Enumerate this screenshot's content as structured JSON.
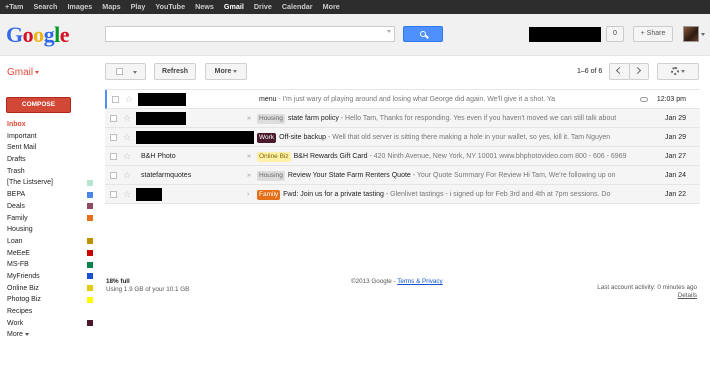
{
  "topbar": {
    "items": [
      "+Tam",
      "Search",
      "Images",
      "Maps",
      "Play",
      "YouTube",
      "News",
      "Gmail",
      "Drive",
      "Calendar",
      "More"
    ],
    "active": "Gmail"
  },
  "header": {
    "logo": {
      "l1": "G",
      "l2": "o",
      "l3": "o",
      "l4": "g",
      "l5": "l",
      "l6": "e"
    },
    "search_value": "",
    "notification_count": "0",
    "share_label": "+ Share"
  },
  "app_label": "Gmail",
  "toolbar": {
    "refresh": "Refresh",
    "more": "More",
    "pager": "1–6 of 6"
  },
  "sidebar": {
    "compose": "COMPOSE",
    "items": [
      {
        "label": "Inbox",
        "active": true,
        "color": ""
      },
      {
        "label": "Important",
        "color": ""
      },
      {
        "label": "Sent Mail",
        "color": ""
      },
      {
        "label": "Drafts",
        "color": ""
      },
      {
        "label": "Trash",
        "color": ""
      },
      {
        "label": "[The Listserve]",
        "color": "#b9e4d0"
      },
      {
        "label": "BEPA",
        "color": "#4a86e8"
      },
      {
        "label": "Deals",
        "color": "#8e4c5e"
      },
      {
        "label": "Family",
        "color": "#e66f1a"
      },
      {
        "label": "Housing",
        "color": ""
      },
      {
        "label": "Loan",
        "color": "#bf9000"
      },
      {
        "label": "MeEeE",
        "color": "#cc0000"
      },
      {
        "label": "MS-FB",
        "color": "#0b804b"
      },
      {
        "label": "MyFriends",
        "color": "#1c4fd1"
      },
      {
        "label": "Online Biz",
        "color": "#e6c911"
      },
      {
        "label": "Photog Biz",
        "color": "#ffff00"
      },
      {
        "label": "Recipes",
        "color": ""
      },
      {
        "label": "Work",
        "color": "#4a1a2c"
      },
      {
        "label": "More",
        "color": ""
      }
    ]
  },
  "messages": [
    {
      "sender": "",
      "redacted": true,
      "redact_w": 48,
      "important": "",
      "label": "",
      "subject": "menu",
      "snippet": " - I'm just wary of playing around and losing what George did again. We'll give it a shot. Ya",
      "attachment": true,
      "date": "12:03 pm"
    },
    {
      "sender": "",
      "redacted": true,
      "redact_w": 50,
      "important": "»",
      "label": "Housing",
      "label_bg": "#dddddd",
      "label_fg": "#666666",
      "subject": "state farm policy",
      "snippet": " - Hello Tam, Thanks for responding. Yes even if you haven't moved we can still talk about",
      "attachment": false,
      "date": "Jan 29"
    },
    {
      "sender": "",
      "redacted": true,
      "redact_w": 118,
      "important": "",
      "label": "Work",
      "label_bg": "#4a1a2c",
      "label_fg": "#ffffff",
      "subject": "Off-site backup",
      "snippet": " - Well that old server is sitting there making a hole in your wallet, so yes, kill it. Tam Nguyen",
      "attachment": false,
      "date": "Jan 29"
    },
    {
      "sender": "B&H Photo",
      "redacted": false,
      "important": "»",
      "label": "Online Biz",
      "label_bg": "#fff2a8",
      "label_fg": "#7a6200",
      "subject": "B&H Rewards Gift Card",
      "snippet": " - 420 Ninth Avenue, New York, NY 10001 www.bhphotovideo.com 800 - 606 - 6969",
      "attachment": false,
      "date": "Jan 27"
    },
    {
      "sender": "statefarmquotes",
      "redacted": false,
      "important": "»",
      "label": "Housing",
      "label_bg": "#dddddd",
      "label_fg": "#666666",
      "subject": "Review Your State Farm Renters Quote",
      "snippet": " - Your Quote Summary For Review Hi Tam, We're following up on",
      "attachment": false,
      "date": "Jan 24"
    },
    {
      "sender": "",
      "redacted": true,
      "redact_w": 26,
      "important": "›",
      "label": "Family",
      "label_bg": "#e66f1a",
      "label_fg": "#ffffff",
      "subject": "Fwd: Join us for a private tasting",
      "snippet": " - Glenlivet tastings - i signed up for Feb 3rd and 4th at 7pm sessions. Do",
      "attachment": false,
      "date": "Jan 22"
    }
  ],
  "footer": {
    "usage_percent": "18% full",
    "usage_detail": "Using 1.9 GB of your 10.1 GB",
    "copyright": "©2013 Google - ",
    "terms": "Terms & Privacy",
    "activity": "Last account activity: 0 minutes ago",
    "details": "Details"
  }
}
